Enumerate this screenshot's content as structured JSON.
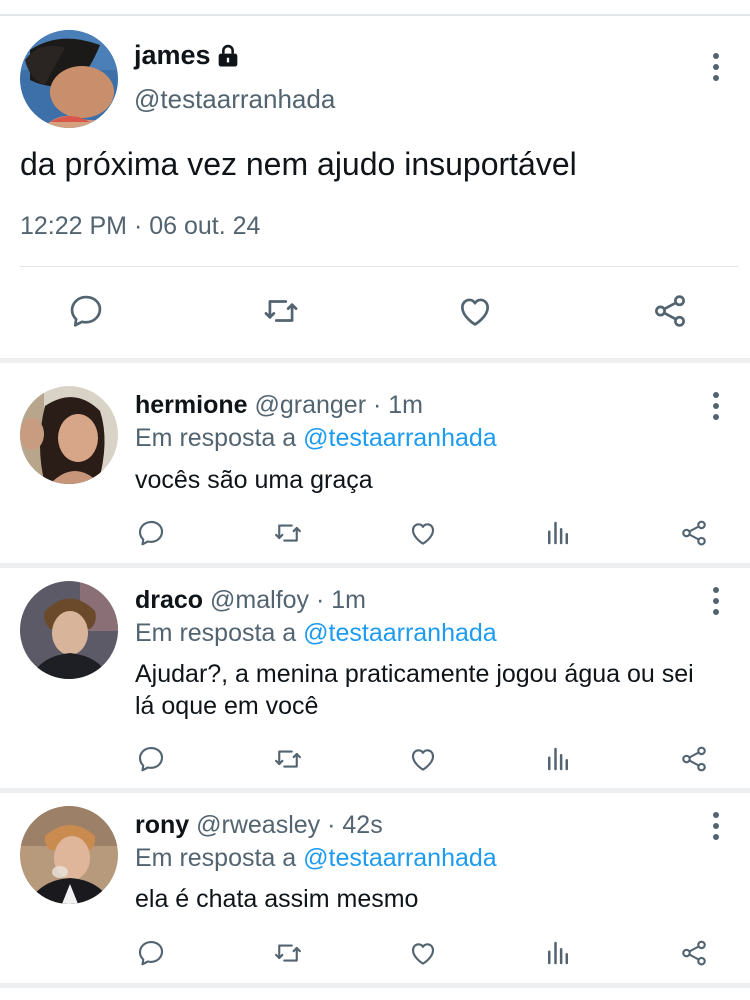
{
  "main_tweet": {
    "author_name": "james",
    "handle": "@testaarranhada",
    "text": "da próxima vez nem ajudo insuportável",
    "timestamp": "12:22 PM · 06 out. 24",
    "icons": [
      "lock-icon",
      "more-icon",
      "reply-icon",
      "retweet-icon",
      "like-icon",
      "share-icon"
    ]
  },
  "replies": [
    {
      "name": "hermione",
      "handle_time": "@granger · 1m",
      "reply_to_prefix": "Em resposta a",
      "reply_to_handle": "@testaarranhada",
      "text": "vocês são uma graça"
    },
    {
      "name": "draco",
      "handle_time": "@malfoy · 1m",
      "reply_to_prefix": "Em resposta a",
      "reply_to_handle": "@testaarranhada",
      "text": "Ajudar?, a menina praticamente jogou água ou sei lá oque em você"
    },
    {
      "name": "rony",
      "handle_time": "@rweasley · 42s",
      "reply_to_prefix": "Em resposta a",
      "reply_to_handle": "@testaarranhada",
      "text": "ela é chata assim mesmo"
    }
  ],
  "reply_action_icons": [
    "reply-icon",
    "retweet-icon",
    "like-icon",
    "analytics-icon",
    "share-icon"
  ],
  "colors": {
    "text": "#0f1419",
    "secondary": "#536471",
    "link": "#1d9bf0",
    "divider": "#eceef0"
  }
}
